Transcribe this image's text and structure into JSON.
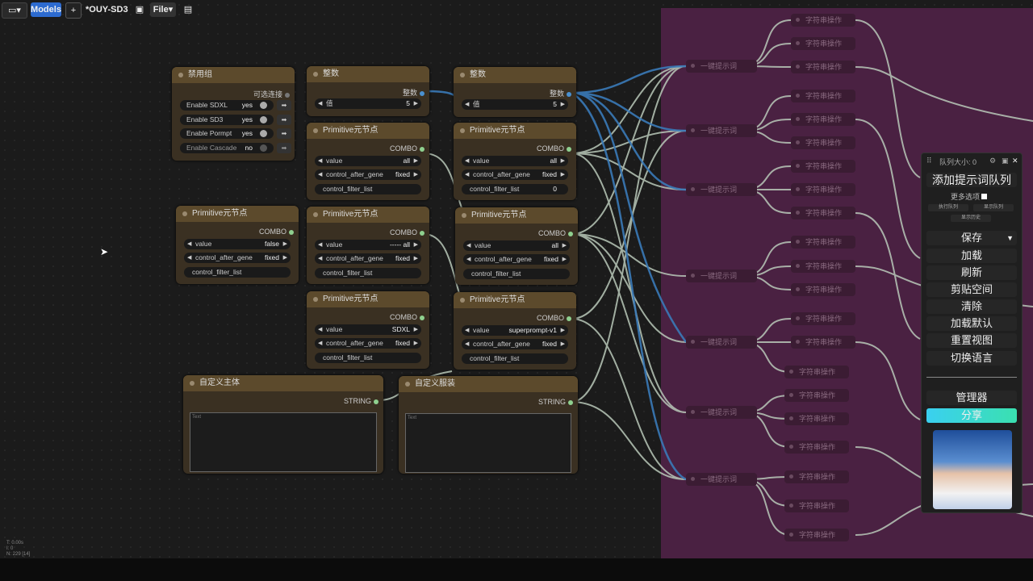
{
  "toolbar": {
    "models": "Models",
    "plus": "+",
    "title": "*OUY-SD3",
    "file": "File"
  },
  "nodes": {
    "disable_group": {
      "title": "禁用组",
      "output": "可选连接",
      "items": [
        {
          "label": "Enable SDXL",
          "value": "yes"
        },
        {
          "label": "Enable SD3",
          "value": "yes"
        },
        {
          "label": "Enable Pormpt",
          "value": "yes"
        },
        {
          "label": "Enable Cascade",
          "value": "no"
        }
      ]
    },
    "int1": {
      "title": "整数",
      "output": "整数",
      "label": "值",
      "value": "5"
    },
    "int2": {
      "title": "整数",
      "output": "整数",
      "label": "值",
      "value": "5"
    },
    "prim_a1": {
      "title": "Primitive元节点",
      "output": "COMBO",
      "value": "all",
      "cag": "control_after_gene",
      "cag_value": "fixed",
      "cfl": "control_filter_list",
      "cfl_value": ""
    },
    "prim_a2": {
      "title": "Primitive元节点",
      "output": "COMBO",
      "value": "all",
      "cag": "control_after_gene",
      "cag_value": "fixed",
      "cfl": "control_filter_list",
      "cfl_value": "0"
    },
    "prim_b0": {
      "title": "Primitive元节点",
      "output": "COMBO",
      "value": "false",
      "cag": "control_after_gene",
      "cag_value": "fixed",
      "cfl": "control_filter_list"
    },
    "prim_b1": {
      "title": "Primitive元节点",
      "output": "COMBO",
      "value": "----- all",
      "cag": "control_after_gene",
      "cag_value": "fixed",
      "cfl": "control_filter_list"
    },
    "prim_b2": {
      "title": "Primitive元节点",
      "output": "COMBO",
      "value": "all",
      "cag": "control_after_gene",
      "cag_value": "fixed",
      "cfl": "control_filter_list"
    },
    "prim_c1": {
      "title": "Primitive元节点",
      "output": "COMBO",
      "value": "SDXL",
      "cag": "control_after_gene",
      "cag_value": "fixed",
      "cfl": "control_filter_list"
    },
    "prim_c2": {
      "title": "Primitive元节点",
      "output": "COMBO",
      "value": "superprompt-v1",
      "cag": "control_after_gene",
      "cag_value": "fixed",
      "cfl": "control_filter_list"
    },
    "custom_subject": {
      "title": "自定义主体",
      "output": "STRING",
      "placeholder": "Text"
    },
    "custom_clothes": {
      "title": "自定义服装",
      "output": "STRING",
      "placeholder": "Text"
    }
  },
  "value_label": "value",
  "prompt_nodes": [
    "一键提示词",
    "一键提示词",
    "一键提示词",
    "一键提示词",
    "一键提示词",
    "一键提示词",
    "一键提示词"
  ],
  "string_nodes": [
    "字符串操作",
    "字符串操作",
    "字符串操作",
    "字符串操作",
    "字符串操作",
    "字符串操作",
    "字符串操作",
    "字符串操作",
    "字符串操作",
    "字符串操作",
    "字符串操作",
    "字符串操作",
    "字符串操作",
    "字符串操作",
    "字符串操作",
    "字符串操作",
    "字符串操作",
    "字符串操作",
    "字符串操作",
    "字符串操作",
    "字符串操作",
    "字符串操作"
  ],
  "queue": {
    "size": "队列大小: 0",
    "add": "添加提示词队列",
    "more": "更多选项",
    "exec_queue": "执行队列",
    "show_queue": "显示队列",
    "show_history": "显示历史",
    "buttons": [
      "保存",
      "加载",
      "刷新",
      "剪贴空间",
      "清除",
      "加载默认",
      "重置视图",
      "切换语言"
    ],
    "manager": "管理器",
    "share": "分享"
  },
  "stats": {
    "t": "T: 0.00s",
    "i": "I: 0",
    "n": "N: 229 [14]"
  }
}
